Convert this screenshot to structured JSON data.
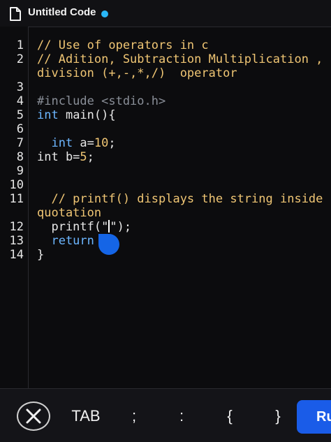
{
  "header": {
    "title": "Untitled Code",
    "unsaved_indicator_color": "#29b6f6",
    "icon": "file-icon"
  },
  "editor": {
    "line_numbers": [
      "1",
      "2",
      "",
      "3",
      "4",
      "5",
      "6",
      "7",
      "8",
      "9",
      "10",
      "11",
      "",
      "12",
      "13",
      "14"
    ],
    "lines": [
      [
        {
          "t": "// Use of operators in c",
          "c": "comment"
        }
      ],
      [
        {
          "t": "// Adition, Subtraction Multiplication ,",
          "c": "comment"
        }
      ],
      [
        {
          "t": "division (+,-,*,/)  operator",
          "c": "comment"
        }
      ],
      [],
      [
        {
          "t": "#include <stdio.h>",
          "c": "pre"
        }
      ],
      [
        {
          "t": "int",
          "c": "type"
        },
        {
          "t": " main(){",
          "c": "plain"
        }
      ],
      [],
      [
        {
          "t": "  int",
          "c": "type"
        },
        {
          "t": " a=",
          "c": "plain"
        },
        {
          "t": "10",
          "c": "num"
        },
        {
          "t": ";",
          "c": "plain"
        }
      ],
      [
        {
          "t": "int b=",
          "c": "plain"
        },
        {
          "t": "5",
          "c": "num"
        },
        {
          "t": ";",
          "c": "plain"
        }
      ],
      [],
      [],
      [
        {
          "t": "  // printf() displays the string inside",
          "c": "comment"
        }
      ],
      [
        {
          "t": "quotation",
          "c": "comment"
        }
      ],
      [
        {
          "t": "  printf(\"",
          "c": "plain"
        },
        {
          "t": "CURSOR",
          "c": "cursor"
        },
        {
          "t": "\");",
          "c": "plain"
        }
      ],
      [
        {
          "t": "  return",
          "c": "kw"
        }
      ],
      [
        {
          "t": "}",
          "c": "plain"
        }
      ]
    ]
  },
  "keyboard_bar": {
    "close_icon": "close-icon",
    "keys": [
      "TAB",
      ";",
      ":",
      "{",
      "}"
    ],
    "run_label": "Ru"
  }
}
